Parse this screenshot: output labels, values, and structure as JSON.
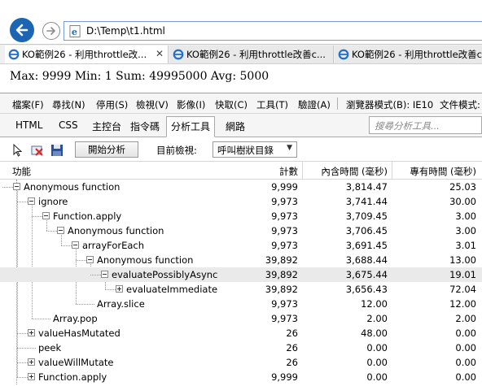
{
  "browser": {
    "address": "D:\\Temp\\t1.html",
    "tabs": [
      {
        "title": "KO範例26 - 利用throttle改...",
        "active": true,
        "closable": true
      },
      {
        "title": "KO範例26 - 利用throttle改善c...",
        "active": false,
        "closable": false
      },
      {
        "title": "KO範例26 - 利用throttle改善c",
        "active": false,
        "closable": false
      }
    ],
    "tab_close_glyph": "✕"
  },
  "page": {
    "stats": "Max: 9999 Min: 1 Sum: 49995000 Avg: 5000"
  },
  "devtools": {
    "menu": [
      "檔案(F)",
      "尋找(N)",
      "停用(S)",
      "檢視(V)",
      "影像(I)",
      "快取(C)",
      "工具(T)",
      "驗證(A)",
      "瀏覽器模式(B): IE10",
      "文件模式:"
    ],
    "tabs": [
      "HTML",
      "CSS",
      "主控台",
      "指令碼",
      "分析工具",
      "網路"
    ],
    "active_tab": "分析工具",
    "search_placeholder": "搜尋分析工具...",
    "toolbar": {
      "start_button": "開始分析",
      "current_view_label": "目前檢視:",
      "view_value": "呼叫樹狀目錄"
    },
    "columns": {
      "function": "功能",
      "count": "計數",
      "inclusive": "內含時間 (毫秒)",
      "exclusive": "專有時間 (毫秒)"
    },
    "rows": [
      {
        "name": "Anonymous function",
        "depth": 1,
        "toggle": "expanded",
        "count": "9,999",
        "inclusive": "3,814.47",
        "exclusive": "25.03"
      },
      {
        "name": "ignore",
        "depth": 2,
        "toggle": "expanded",
        "count": "9,973",
        "inclusive": "3,741.44",
        "exclusive": "30.00"
      },
      {
        "name": "Function.apply",
        "depth": 3,
        "toggle": "expanded",
        "count": "9,973",
        "inclusive": "3,709.45",
        "exclusive": "3.00"
      },
      {
        "name": "Anonymous function",
        "depth": 4,
        "toggle": "expanded",
        "count": "9,973",
        "inclusive": "3,706.45",
        "exclusive": "3.00"
      },
      {
        "name": "arrayForEach",
        "depth": 5,
        "toggle": "expanded",
        "count": "9,973",
        "inclusive": "3,691.45",
        "exclusive": "3.01"
      },
      {
        "name": "Anonymous function",
        "depth": 6,
        "toggle": "expanded",
        "count": "39,892",
        "inclusive": "3,688.44",
        "exclusive": "13.00"
      },
      {
        "name": "evaluatePossiblyAsync",
        "depth": 7,
        "toggle": "expanded",
        "count": "39,892",
        "inclusive": "3,675.44",
        "exclusive": "19.01",
        "selected": true
      },
      {
        "name": "evaluateImmediate",
        "depth": 8,
        "toggle": "collapsed",
        "count": "39,892",
        "inclusive": "3,656.43",
        "exclusive": "72.04"
      },
      {
        "name": "Array.slice",
        "depth": 6,
        "toggle": "none",
        "count": "9,973",
        "inclusive": "12.00",
        "exclusive": "12.00"
      },
      {
        "name": "Array.pop",
        "depth": 3,
        "toggle": "none",
        "count": "9,973",
        "inclusive": "2.00",
        "exclusive": "2.00"
      },
      {
        "name": "valueHasMutated",
        "depth": 2,
        "toggle": "collapsed",
        "count": "26",
        "inclusive": "48.00",
        "exclusive": "0.00"
      },
      {
        "name": "peek",
        "depth": 2,
        "toggle": "none",
        "count": "26",
        "inclusive": "0.00",
        "exclusive": "0.00"
      },
      {
        "name": "valueWillMutate",
        "depth": 2,
        "toggle": "collapsed",
        "count": "26",
        "inclusive": "0.00",
        "exclusive": "0.00"
      },
      {
        "name": "Function.apply",
        "depth": 2,
        "toggle": "collapsed",
        "count": "9,999",
        "inclusive": "0.00",
        "exclusive": "0.00"
      }
    ]
  }
}
